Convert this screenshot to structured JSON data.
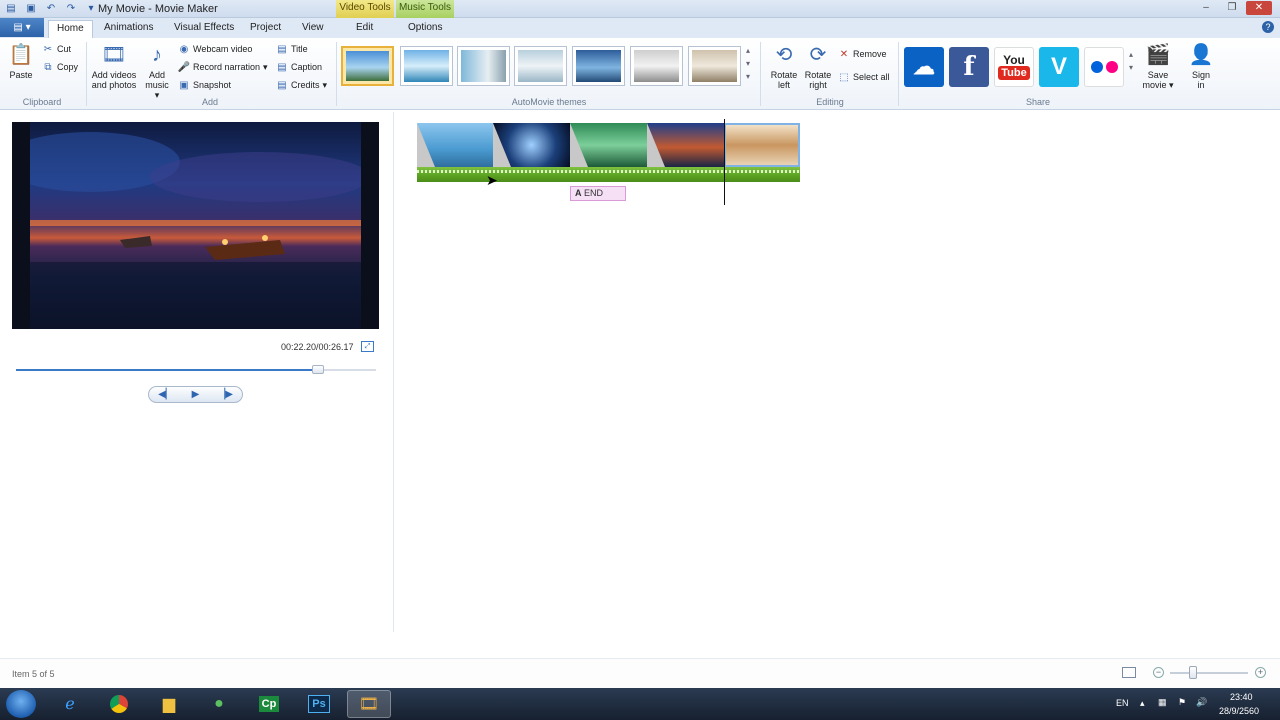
{
  "window": {
    "title": "My Movie - Movie Maker",
    "context_video": "Video Tools",
    "context_music": "Music Tools"
  },
  "tabs": {
    "home": "Home",
    "animations": "Animations",
    "visual_effects": "Visual Effects",
    "project": "Project",
    "view": "View",
    "edit": "Edit",
    "options": "Options"
  },
  "ribbon": {
    "clipboard": {
      "label": "Clipboard",
      "paste": "Paste",
      "cut": "Cut",
      "copy": "Copy"
    },
    "add": {
      "label": "Add",
      "add_videos": "Add videos",
      "add_videos2": "and photos",
      "add_music": "Add",
      "add_music2": "music",
      "webcam": "Webcam video",
      "narration": "Record narration",
      "snapshot": "Snapshot",
      "title": "Title",
      "caption": "Caption",
      "credits": "Credits"
    },
    "automovie": {
      "label": "AutoMovie themes"
    },
    "editing": {
      "label": "Editing",
      "rotate_left": "Rotate",
      "rotate_left2": "left",
      "rotate_right": "Rotate",
      "rotate_right2": "right",
      "remove": "Remove",
      "select_all": "Select all"
    },
    "share": {
      "label": "Share",
      "youtube_top": "You",
      "youtube_bottom": "Tube",
      "facebook": "f",
      "vimeo": "V",
      "save_movie": "Save",
      "save_movie2": "movie",
      "sign_in": "Sign",
      "sign_in2": "in"
    }
  },
  "preview": {
    "time": "00:22.20/00:26.17",
    "progress": 0.84
  },
  "storyboard": {
    "end_caption": "END",
    "caption_glyph": "A"
  },
  "status": {
    "item_text": "Item 5 of 5",
    "zoom_level": 0.3
  },
  "taskbar": {
    "lang": "EN",
    "time": "23:40",
    "date": "28/9/2560"
  },
  "colors": {
    "accent": "#2c62a8",
    "theme_selected": "#e8b23a",
    "audio_green": "#5aa020"
  }
}
